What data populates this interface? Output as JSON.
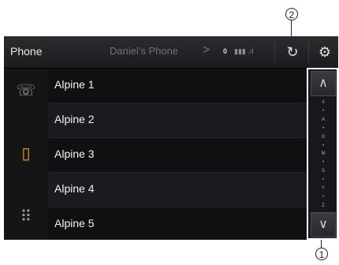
{
  "callouts": {
    "top": "2",
    "bottom": "1"
  },
  "header": {
    "title": "Phone",
    "device_name": "Daniel's Phone",
    "chevron": ">",
    "battery_label": "0",
    "signal_glyph": "▮▮▮ .ıl",
    "refresh_icon": "↻",
    "settings_icon": "⚙"
  },
  "sidebar": {
    "items": [
      {
        "name": "recent-calls",
        "glyph": "☏"
      },
      {
        "name": "contacts",
        "glyph": "▯"
      },
      {
        "name": "keypad",
        "glyph": "⠿"
      }
    ],
    "active_color": "#f0a020"
  },
  "contacts": [
    {
      "label": "Alpine 1"
    },
    {
      "label": "Alpine 2"
    },
    {
      "label": "Alpine 3"
    },
    {
      "label": "Alpine 4"
    },
    {
      "label": "Alpine 5"
    }
  ],
  "scrollbar": {
    "up_glyph": "∧",
    "down_glyph": "∨",
    "index": [
      "#",
      "•",
      "A",
      "•",
      "G",
      "•",
      "M",
      "•",
      "S",
      "•",
      "Y",
      "•",
      "Z"
    ]
  }
}
